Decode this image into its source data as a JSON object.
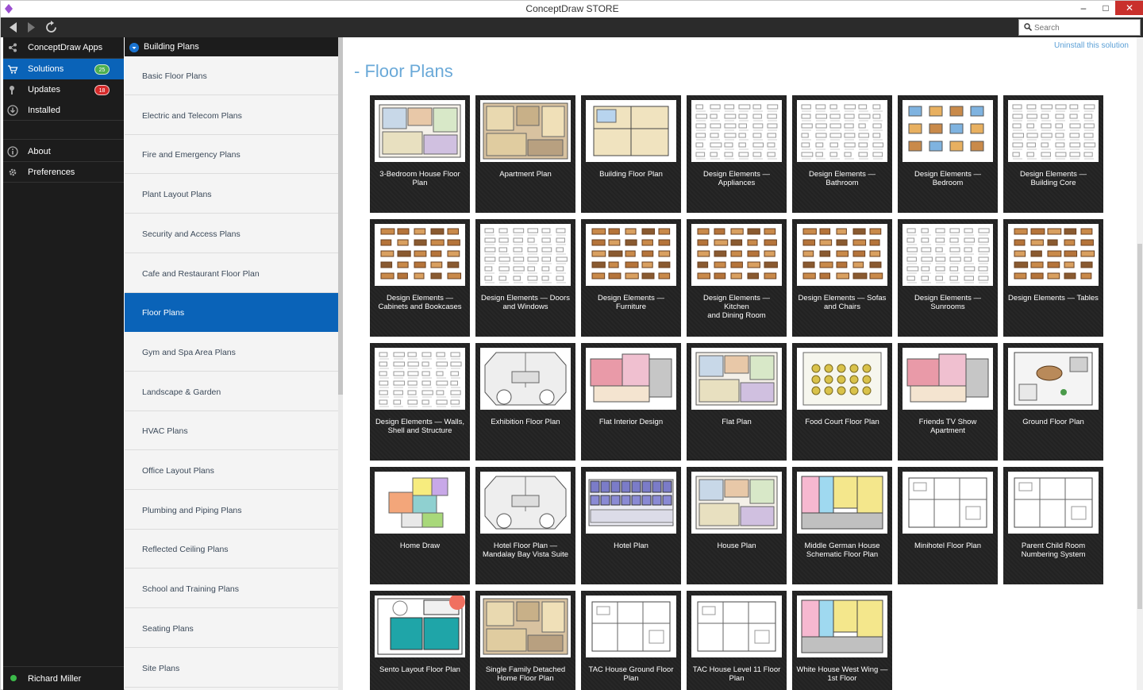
{
  "window": {
    "title": "ConceptDraw STORE"
  },
  "search": {
    "placeholder": "Search"
  },
  "sidebar": {
    "items": [
      {
        "label": "ConceptDraw Apps",
        "icon": "apps-icon"
      },
      {
        "label": "Solutions",
        "icon": "cart-icon",
        "badge": "25",
        "active": true
      },
      {
        "label": "Updates",
        "icon": "updates-icon",
        "badge": "18"
      },
      {
        "label": "Installed",
        "icon": "download-icon"
      },
      {
        "label": "About",
        "icon": "info-icon"
      },
      {
        "label": "Preferences",
        "icon": "gear-icon"
      }
    ],
    "user": "Richard Miller"
  },
  "categories": {
    "header": "Building Plans",
    "items": [
      "Basic Floor Plans",
      "Electric and Telecom Plans",
      "Fire and Emergency Plans",
      "Plant Layout Plans",
      "Security and Access Plans",
      "Cafe and Restaurant Floor Plan",
      "Floor Plans",
      "Gym and Spa Area Plans",
      "Landscape & Garden",
      "HVAC Plans",
      "Office Layout Plans",
      "Plumbing and Piping Plans",
      "Reflected Ceiling Plans",
      "School and Training Plans",
      "Seating Plans",
      "Site Plans"
    ],
    "active": "Floor Plans"
  },
  "main": {
    "uninstall": "Uninstall this solution",
    "title": "- Floor Plans",
    "cards": [
      {
        "line1": "3-Bedroom House Floor",
        "line2": "Plan",
        "kind": "house"
      },
      {
        "line1": "Apartment Plan",
        "line2": "",
        "kind": "apt"
      },
      {
        "line1": "Building Floor Plan",
        "line2": "",
        "kind": "building"
      },
      {
        "line1": "Design Elements —",
        "line2": "Appliances",
        "kind": "elements"
      },
      {
        "line1": "Design Elements —",
        "line2": "Bathroom",
        "kind": "elements"
      },
      {
        "line1": "Design Elements —",
        "line2": "Bedroom",
        "kind": "bedroom"
      },
      {
        "line1": "Design Elements —",
        "line2": "Building Core",
        "kind": "elements"
      },
      {
        "line1": "Design Elements —",
        "line2": "Cabinets and Bookcases",
        "kind": "furniture"
      },
      {
        "line1": "Design Elements — Doors",
        "line2": "and Windows",
        "kind": "elements"
      },
      {
        "line1": "Design Elements —",
        "line2": "Furniture",
        "kind": "furniture"
      },
      {
        "line1": "Design Elements — Kitchen",
        "line2": "and Dining Room",
        "kind": "furniture"
      },
      {
        "line1": "Design Elements — Sofas",
        "line2": "and Chairs",
        "kind": "furniture"
      },
      {
        "line1": "Design Elements —",
        "line2": "Sunrooms",
        "kind": "elements"
      },
      {
        "line1": "Design Elements — Tables",
        "line2": "",
        "kind": "furniture"
      },
      {
        "line1": "Design Elements — Walls,",
        "line2": "Shell and Structure",
        "kind": "elements"
      },
      {
        "line1": "Exhibition Floor Plan",
        "line2": "",
        "kind": "exhibit"
      },
      {
        "line1": "Flat Interior Design",
        "line2": "",
        "kind": "flat"
      },
      {
        "line1": "Flat Plan",
        "line2": "",
        "kind": "house"
      },
      {
        "line1": "Food Court Floor Plan",
        "line2": "",
        "kind": "food"
      },
      {
        "line1": "Friends TV Show",
        "line2": "Apartment",
        "kind": "flat"
      },
      {
        "line1": "Ground Floor Plan",
        "line2": "",
        "kind": "ground"
      },
      {
        "line1": "Home Draw",
        "line2": "",
        "kind": "homedraw"
      },
      {
        "line1": "Hotel Floor Plan —",
        "line2": "Mandalay Bay Vista Suite",
        "kind": "exhibit"
      },
      {
        "line1": "Hotel Plan",
        "line2": "",
        "kind": "hotel"
      },
      {
        "line1": "House Plan",
        "line2": "",
        "kind": "house"
      },
      {
        "line1": "Middle German House",
        "line2": "Schematic Floor Plan",
        "kind": "german"
      },
      {
        "line1": "Minihotel Floor Plan",
        "line2": "",
        "kind": "outline"
      },
      {
        "line1": "Parent Child Room",
        "line2": "Numbering System",
        "kind": "outline"
      },
      {
        "line1": "Sento Layout Floor Plan",
        "line2": "",
        "kind": "sento"
      },
      {
        "line1": "Single Family Detached",
        "line2": "Home Floor Plan",
        "kind": "apt"
      },
      {
        "line1": "TAC House Ground Floor",
        "line2": "Plan",
        "kind": "outline"
      },
      {
        "line1": "TAC House Level 11 Floor",
        "line2": "Plan",
        "kind": "outline"
      },
      {
        "line1": "White House West Wing —",
        "line2": "1st Floor",
        "kind": "german"
      }
    ]
  }
}
